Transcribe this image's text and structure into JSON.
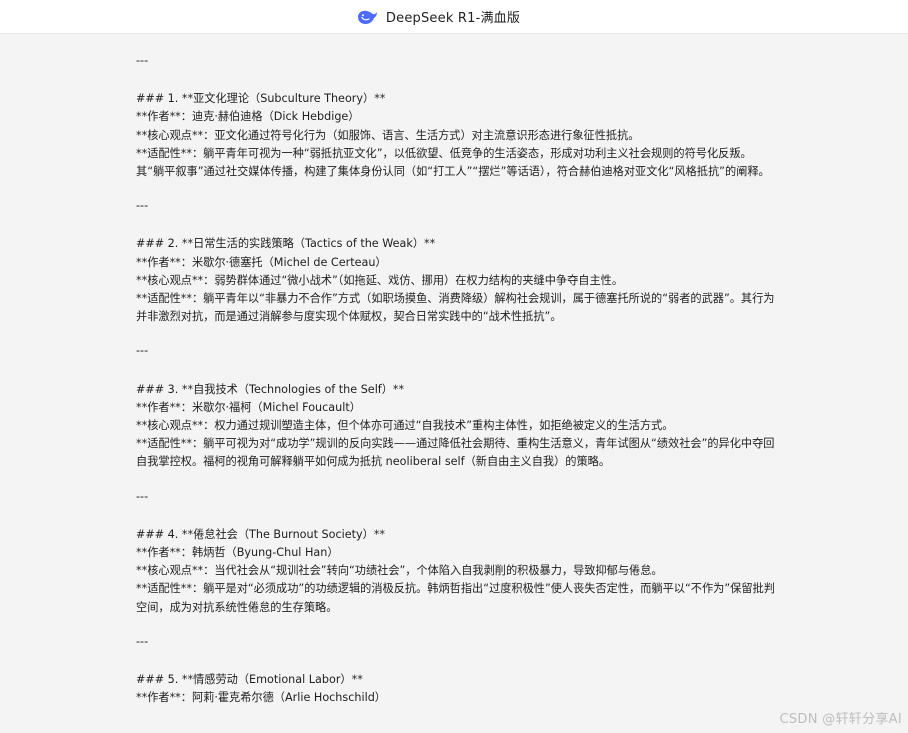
{
  "header": {
    "title": "DeepSeek R1-满血版",
    "logo_icon": "whale-icon",
    "accent": "#4d6bfe"
  },
  "content": {
    "sections": [
      {
        "sep": "---",
        "heading": "### 1. **亚文化理论（Subculture Theory）**",
        "author": "**作者**：迪克·赫伯迪格（Dick Hebdige）",
        "core": "**核心观点**：亚文化通过符号化行为（如服饰、语言、生活方式）对主流意识形态进行象征性抵抗。",
        "fit": "**适配性**：躺平青年可视为一种“弱抵抗亚文化”，以低欲望、低竞争的生活姿态，形成对功利主义社会规则的符号化反叛。其“躺平叙事”通过社交媒体传播，构建了集体身份认同（如“打工人”“摆烂”等话语），符合赫伯迪格对亚文化“风格抵抗”的阐释。"
      },
      {
        "sep": "---",
        "heading": "### 2. **日常生活的实践策略（Tactics of the Weak）**",
        "author": "**作者**：米歇尔·德塞托（Michel de Certeau）",
        "core": "**核心观点**：弱势群体通过“微小战术”（如拖延、戏仿、挪用）在权力结构的夹缝中争夺自主性。",
        "fit": "**适配性**：躺平青年以“非暴力不合作”方式（如职场摸鱼、消费降级）解构社会规训，属于德塞托所说的“弱者的武器”。其行为并非激烈对抗，而是通过消解参与度实现个体赋权，契合日常实践中的“战术性抵抗”。"
      },
      {
        "sep": "---",
        "heading": "### 3. **自我技术（Technologies of the Self）**",
        "author": "**作者**：米歇尔·福柯（Michel Foucault）",
        "core": "**核心观点**：权力通过规训塑造主体，但个体亦可通过“自我技术”重构主体性，如拒绝被定义的生活方式。",
        "fit": "**适配性**：躺平可视为对“成功学”规训的反向实践——通过降低社会期待、重构生活意义，青年试图从“绩效社会”的异化中夺回自我掌控权。福柯的视角可解释躺平如何成为抵抗 neoliberal self（新自由主义自我）的策略。"
      },
      {
        "sep": "---",
        "heading": "### 4. **倦怠社会（The Burnout Society）**",
        "author": "**作者**：韩炳哲（Byung-Chul Han）",
        "core": "**核心观点**：当代社会从“规训社会”转向“功绩社会”，个体陷入自我剥削的积极暴力，导致抑郁与倦怠。",
        "fit": "**适配性**：躺平是对“必须成功”的功绩逻辑的消极反抗。韩炳哲指出“过度积极性”使人丧失否定性，而躺平以“不作为”保留批判空间，成为对抗系统性倦怠的生存策略。"
      },
      {
        "sep": "---",
        "heading": "### 5. **情感劳动（Emotional Labor）**",
        "author": "**作者**：阿莉·霍克希尔德（Arlie Hochschild）"
      }
    ]
  },
  "watermark": "CSDN @轩轩分享AI"
}
